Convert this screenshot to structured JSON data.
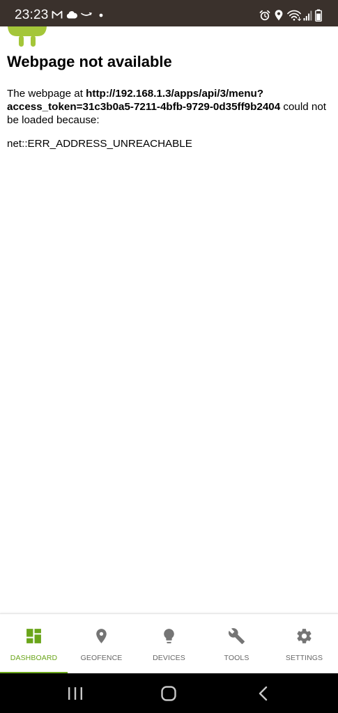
{
  "status_bar": {
    "time": "23:23",
    "left_icons": [
      "gmail-icon",
      "cloud-icon",
      "amazon-icon",
      "dot-icon"
    ],
    "right_icons": [
      "alarm-icon",
      "location-icon",
      "wifi-icon",
      "signal-icon",
      "battery-icon"
    ]
  },
  "error_page": {
    "title": "Webpage not available",
    "prefix": "The webpage at ",
    "url": "http://192.168.1.3/apps/api/3/menu?access_token=31c3b0a5-7211-4bfb-9729-0d35ff9b2404",
    "suffix": " could not be loaded because:",
    "error_code": "net::ERR_ADDRESS_UNREACHABLE"
  },
  "bottom_nav": {
    "items": [
      {
        "label": "DASHBOARD",
        "icon": "dashboard-icon",
        "active": true
      },
      {
        "label": "GEOFENCE",
        "icon": "location-pin-icon",
        "active": false
      },
      {
        "label": "DEVICES",
        "icon": "lightbulb-icon",
        "active": false
      },
      {
        "label": "TOOLS",
        "icon": "wrench-icon",
        "active": false
      },
      {
        "label": "SETTINGS",
        "icon": "gear-icon",
        "active": false
      }
    ]
  },
  "system_nav": [
    "recent-apps-icon",
    "home-icon",
    "back-icon"
  ],
  "colors": {
    "status_bar": "#3a312c",
    "accent": "#6aa51a",
    "android": "#a4c639",
    "inactive_icon": "#757575"
  }
}
